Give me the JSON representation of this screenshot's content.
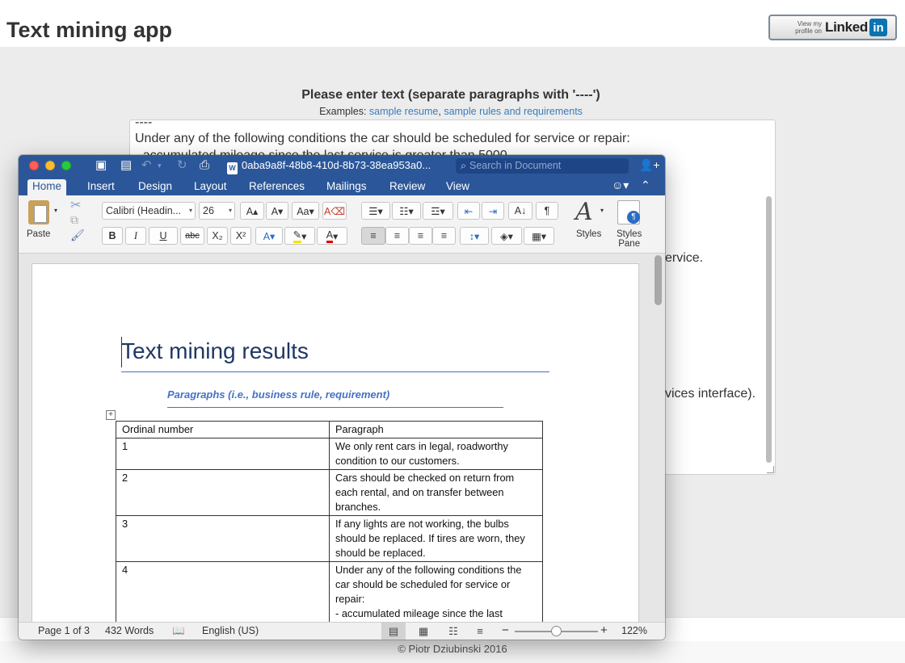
{
  "page": {
    "title": "Text mining app",
    "linkedin": {
      "small_text_1": "View my",
      "small_text_2": "profile on",
      "word": "Linked",
      "box": "in"
    },
    "prompt": "Please enter text (separate paragraphs with '----')",
    "examples_label": "Examples: ",
    "example_links": [
      "sample resume",
      "sample rules and requirements"
    ],
    "example_sep": ", ",
    "textarea_lines": [
      "----",
      "Under any of the following conditions the car should be scheduled for service or repair:",
      "- accumulated mileage since the last service is greater than 5000"
    ],
    "partial_right_1": "ervice.",
    "partial_right_2": "vices interface).",
    "footer": "© Piotr Dziubinski 2016"
  },
  "word": {
    "doc_title": "0aba9a8f-48b8-410d-8b73-38ea953a0...",
    "doc_icon": "W",
    "search_placeholder": "Search in Document",
    "tabs": [
      "Home",
      "Insert",
      "Design",
      "Layout",
      "References",
      "Mailings",
      "Review",
      "View"
    ],
    "active_tab": "Home",
    "ribbon": {
      "paste_label": "Paste",
      "font_name": "Calibri (Headin...",
      "font_size": "26",
      "styles_label": "Styles",
      "styles_pane_label_1": "Styles",
      "styles_pane_label_2": "Pane",
      "bold": "B",
      "italic": "I",
      "underline": "U",
      "strike": "abc",
      "subscript": "X₂",
      "superscript": "X²",
      "pilcrow": "¶"
    },
    "document": {
      "heading": "Text mining results",
      "subheading": "Paragraphs (i.e., business rule, requirement)",
      "table_headers": [
        "Ordinal number",
        "Paragraph"
      ],
      "table_rows": [
        [
          "1",
          "We only rent cars in legal, roadworthy condition to our customers."
        ],
        [
          "2",
          "Cars should be checked on return from each rental, and on transfer between branches."
        ],
        [
          "3",
          "If any lights are not working, the bulbs should be replaced. If tires are worn, they should be replaced."
        ],
        [
          "4",
          "Under any of the following conditions the car should be scheduled for service or repair:"
        ]
      ],
      "row4_extra": "- accumulated mileage since the last"
    },
    "status": {
      "page": "Page 1 of 3",
      "words": "432 Words",
      "language": "English (US)",
      "zoom": "122%",
      "zoom_minus": "−",
      "zoom_plus": "+"
    }
  },
  "colors": {
    "word_blue": "#2b579a",
    "heading_blue": "#1f3864",
    "accent_blue": "#4472c4",
    "link_blue": "#3a7bbd"
  }
}
